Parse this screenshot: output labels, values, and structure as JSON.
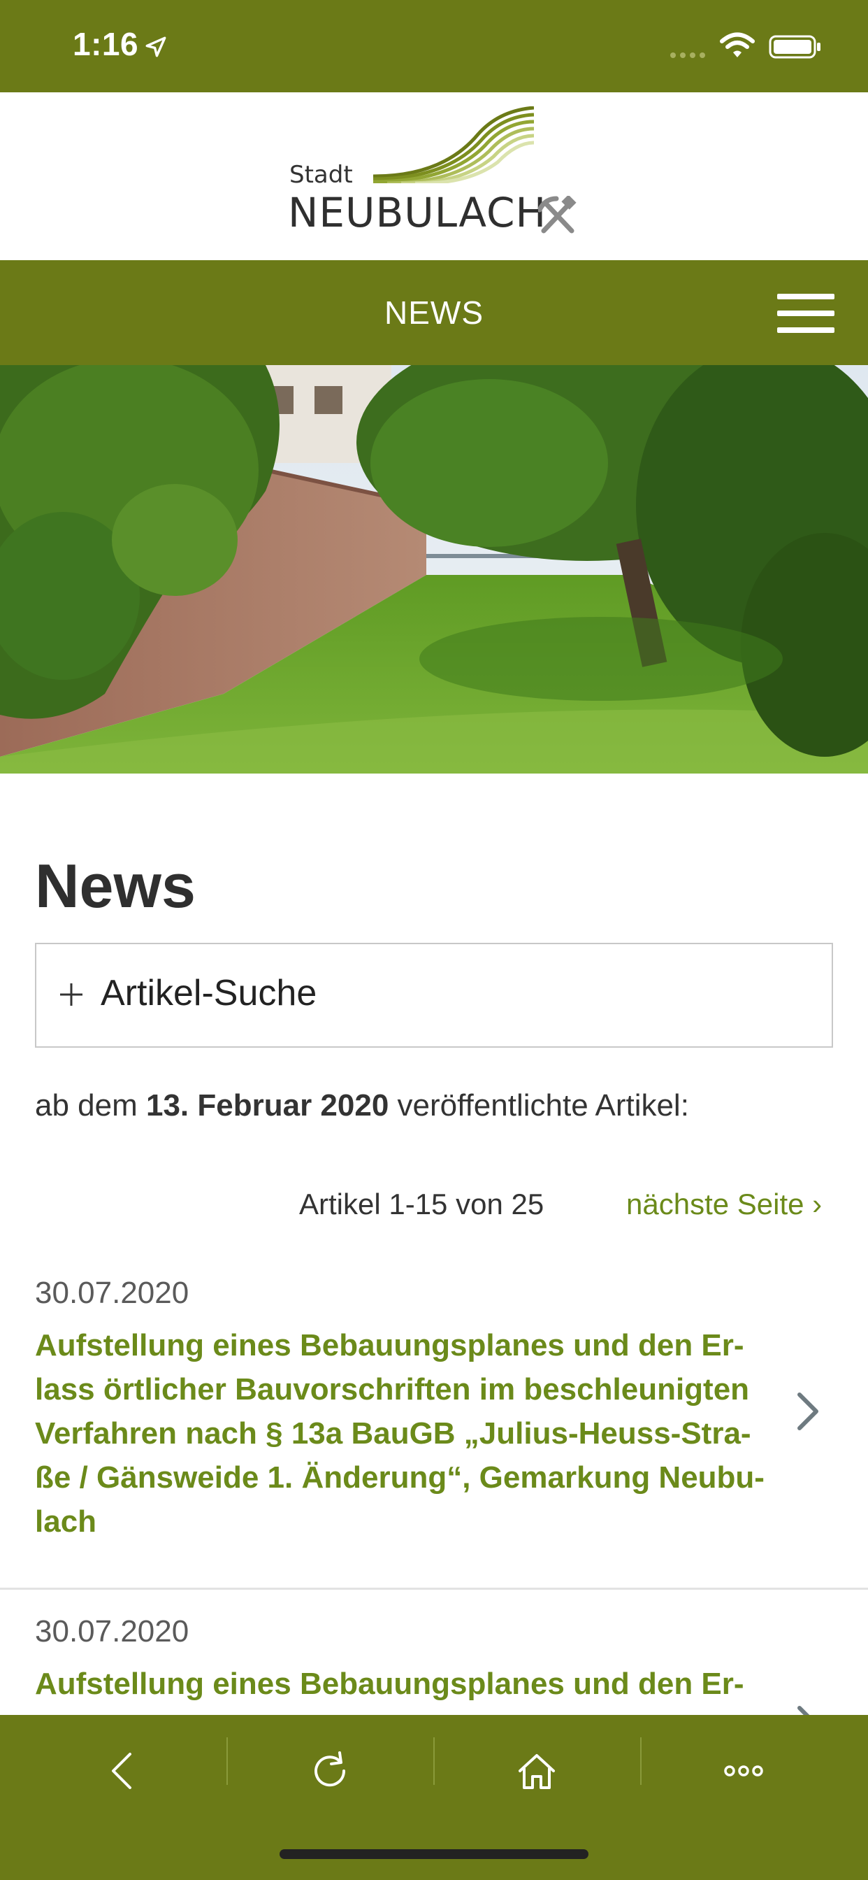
{
  "status_bar": {
    "time": "1:16",
    "icons": [
      "location-arrow-icon",
      "signal-dots-icon",
      "wifi-icon",
      "battery-icon"
    ]
  },
  "logo": {
    "stadt": "Stadt",
    "name": "NEUBULACH",
    "icons": [
      "swoosh-logo-icon",
      "hammer-pick-icon"
    ]
  },
  "nav": {
    "title": "NEWS",
    "menu_icon": "hamburger-menu-icon"
  },
  "main": {
    "title": "News",
    "search_toggle": {
      "icon": "plus-icon",
      "label": "Artikel-Suche"
    },
    "published": {
      "prefix": "ab dem ",
      "date": "13. Februar 2020",
      "suffix": " veröffentlichte Artikel:"
    },
    "pager": {
      "count": "Artikel 1-15 von 25",
      "next": "nächste Seite ›"
    },
    "articles": [
      {
        "date": "30.07.2020",
        "title_lines": [
          "Aufstellung eines Bebauungsplanes und den Er-",
          "lass örtlicher Bauvorschriften im beschleunigten",
          "Verfahren nach § 13a BauGB „Julius-Heuss-Stra-",
          "ße / Gänsweide 1. Änderung“, Gemarkung Neubu-",
          "lach"
        ]
      },
      {
        "date": "30.07.2020",
        "title_lines": [
          "Aufstellung eines Bebauungsplanes und den Er-"
        ]
      }
    ]
  },
  "toolbar": {
    "buttons": [
      "back-icon",
      "reload-icon",
      "home-icon",
      "more-icon"
    ]
  },
  "colors": {
    "brand_green": "#6b7a17",
    "link_green": "#6b8a1a",
    "text_dark": "#333333"
  }
}
